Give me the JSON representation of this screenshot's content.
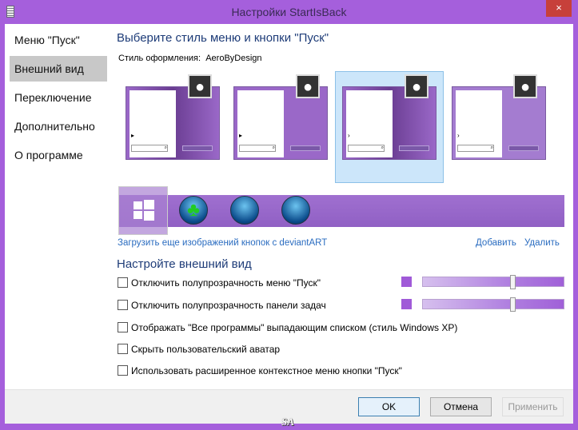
{
  "window": {
    "title": "Настройки StartIsBack",
    "close": "×"
  },
  "sidebar": {
    "items": [
      {
        "label": "Меню \"Пуск\""
      },
      {
        "label": "Внешний вид"
      },
      {
        "label": "Переключение"
      },
      {
        "label": "Дополнительно"
      },
      {
        "label": "О программе"
      }
    ],
    "selected_index": 1
  },
  "style_section": {
    "heading": "Выберите стиль меню и кнопки \"Пуск\"",
    "style_label": "Стиль оформления:",
    "style_value": "AeroByDesign",
    "selected_thumb": 2
  },
  "links": {
    "deviantart": "Загрузить еще изображений кнопок с deviantART",
    "add": "Добавить",
    "remove": "Удалить"
  },
  "appearance": {
    "heading": "Настройте внешний вид",
    "options": [
      {
        "label": "Отключить полупрозрачность меню \"Пуск\"",
        "checked": false,
        "transparency": 0.64,
        "color": "#a05ad8"
      },
      {
        "label": "Отключить полупрозрачность панели задач",
        "checked": false,
        "transparency": 0.64,
        "color": "#a05ad8"
      },
      {
        "label": "Отображать \"Все программы\" выпадающим списком (стиль Windows XP)",
        "checked": false
      },
      {
        "label": "Скрыть пользовательский аватар",
        "checked": false
      },
      {
        "label": "Использовать расширенное контекстное меню кнопки \"Пуск\"",
        "checked": false
      }
    ]
  },
  "buttons": {
    "ok": "OK",
    "cancel": "Отмена",
    "apply": "Применить"
  },
  "watermark": "SA"
}
